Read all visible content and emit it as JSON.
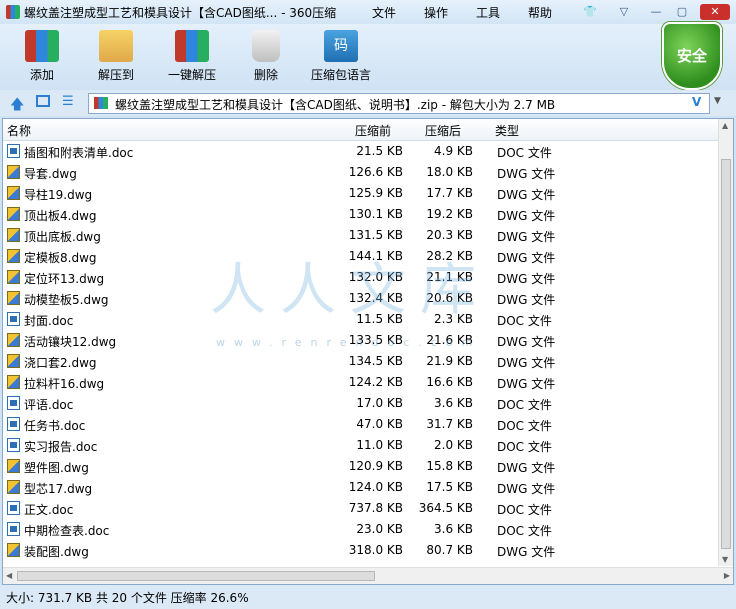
{
  "window": {
    "title": "螺纹盖注塑成型工艺和模具设计【含CAD图纸... - 360压缩",
    "menus": [
      "文件",
      "操作",
      "工具",
      "帮助"
    ],
    "controls": [
      "minimize",
      "maximize",
      "close"
    ]
  },
  "toolbar": {
    "buttons": [
      {
        "label": "添加",
        "icon": "add-archive-icon"
      },
      {
        "label": "解压到",
        "icon": "extract-to-icon"
      },
      {
        "label": "一键解压",
        "icon": "one-click-extract-icon"
      },
      {
        "label": "删除",
        "icon": "trash-icon"
      },
      {
        "label": "压缩包语言",
        "icon": "archive-encoding-icon"
      }
    ],
    "security_badge": "安全",
    "encoding_glyph": "码"
  },
  "address": {
    "path": "螺纹盖注塑成型工艺和模具设计【含CAD图纸、说明书】.zip - 解包大小为 2.7 MB",
    "dropdown_glyph": "V"
  },
  "columns": [
    "名称",
    "压缩前",
    "压缩后",
    "类型"
  ],
  "files": [
    {
      "name": "插图和附表清单.doc",
      "before": "21.5 KB",
      "after": "4.9 KB",
      "type": "DOC 文件",
      "kind": "doc"
    },
    {
      "name": "导套.dwg",
      "before": "126.6 KB",
      "after": "18.0 KB",
      "type": "DWG 文件",
      "kind": "dwg"
    },
    {
      "name": "导柱19.dwg",
      "before": "125.9 KB",
      "after": "17.7 KB",
      "type": "DWG 文件",
      "kind": "dwg"
    },
    {
      "name": "顶出板4.dwg",
      "before": "130.1 KB",
      "after": "19.2 KB",
      "type": "DWG 文件",
      "kind": "dwg"
    },
    {
      "name": "顶出底板.dwg",
      "before": "131.5 KB",
      "after": "20.3 KB",
      "type": "DWG 文件",
      "kind": "dwg"
    },
    {
      "name": "定模板8.dwg",
      "before": "144.1 KB",
      "after": "28.2 KB",
      "type": "DWG 文件",
      "kind": "dwg"
    },
    {
      "name": "定位环13.dwg",
      "before": "132.0 KB",
      "after": "21.1 KB",
      "type": "DWG 文件",
      "kind": "dwg"
    },
    {
      "name": "动模垫板5.dwg",
      "before": "132.4 KB",
      "after": "20.6 KB",
      "type": "DWG 文件",
      "kind": "dwg"
    },
    {
      "name": "封面.doc",
      "before": "11.5 KB",
      "after": "2.3 KB",
      "type": "DOC 文件",
      "kind": "doc"
    },
    {
      "name": "活动镶块12.dwg",
      "before": "133.5 KB",
      "after": "21.6 KB",
      "type": "DWG 文件",
      "kind": "dwg"
    },
    {
      "name": "浇口套2.dwg",
      "before": "134.5 KB",
      "after": "21.9 KB",
      "type": "DWG 文件",
      "kind": "dwg"
    },
    {
      "name": "拉料杆16.dwg",
      "before": "124.2 KB",
      "after": "16.6 KB",
      "type": "DWG 文件",
      "kind": "dwg"
    },
    {
      "name": "评语.doc",
      "before": "17.0 KB",
      "after": "3.6 KB",
      "type": "DOC 文件",
      "kind": "doc"
    },
    {
      "name": "任务书.doc",
      "before": "47.0 KB",
      "after": "31.7 KB",
      "type": "DOC 文件",
      "kind": "doc"
    },
    {
      "name": "实习报告.doc",
      "before": "11.0 KB",
      "after": "2.0 KB",
      "type": "DOC 文件",
      "kind": "doc"
    },
    {
      "name": "塑件图.dwg",
      "before": "120.9 KB",
      "after": "15.8 KB",
      "type": "DWG 文件",
      "kind": "dwg"
    },
    {
      "name": "型芯17.dwg",
      "before": "124.0 KB",
      "after": "17.5 KB",
      "type": "DWG 文件",
      "kind": "dwg"
    },
    {
      "name": "正文.doc",
      "before": "737.8 KB",
      "after": "364.5 KB",
      "type": "DOC 文件",
      "kind": "doc"
    },
    {
      "name": "中期检查表.doc",
      "before": "23.0 KB",
      "after": "3.6 KB",
      "type": "DOC 文件",
      "kind": "doc"
    },
    {
      "name": "装配图.dwg",
      "before": "318.0 KB",
      "after": "80.7 KB",
      "type": "DWG 文件",
      "kind": "dwg"
    }
  ],
  "status": "大小: 731.7 KB 共 20 个文件 压缩率 26.6%",
  "watermark": {
    "text": "人人文库",
    "url": "www.renrendoc.com"
  }
}
